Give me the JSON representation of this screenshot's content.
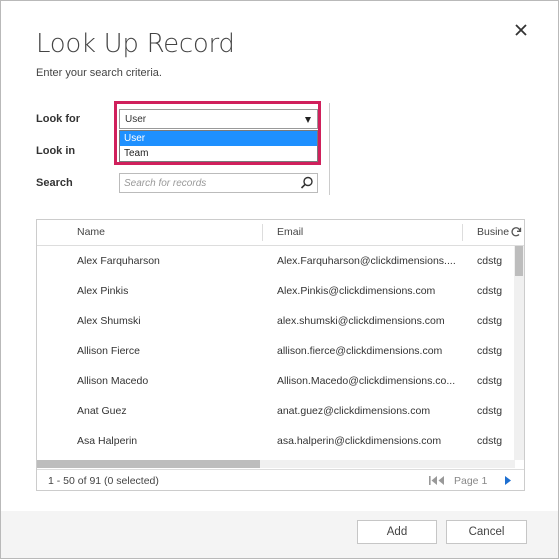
{
  "dialog": {
    "title": "Look Up Record",
    "subtitle": "Enter your search criteria."
  },
  "form": {
    "look_for_label": "Look for",
    "look_in_label": "Look in",
    "search_label": "Search",
    "look_for_value": "User",
    "look_for_options": [
      "User",
      "Team"
    ],
    "search_placeholder": "Search for records"
  },
  "grid": {
    "columns": [
      "Name",
      "Email",
      "Busine"
    ],
    "rows": [
      {
        "name": "Alex Farquharson",
        "email": "Alex.Farquharson@clickdimensions....",
        "business": "cdstg"
      },
      {
        "name": "Alex Pinkis",
        "email": "Alex.Pinkis@clickdimensions.com",
        "business": "cdstg"
      },
      {
        "name": "Alex Shumski",
        "email": "alex.shumski@clickdimensions.com",
        "business": "cdstg"
      },
      {
        "name": "Allison Fierce",
        "email": "allison.fierce@clickdimensions.com",
        "business": "cdstg"
      },
      {
        "name": "Allison Macedo",
        "email": "Allison.Macedo@clickdimensions.co...",
        "business": "cdstg"
      },
      {
        "name": "Anat Guez",
        "email": "anat.guez@clickdimensions.com",
        "business": "cdstg"
      },
      {
        "name": "Asa Halperin",
        "email": "asa.halperin@clickdimensions.com",
        "business": "cdstg"
      }
    ],
    "footer_info": "1 - 50  of 91 (0 selected)",
    "page_label": "Page 1"
  },
  "buttons": {
    "add": "Add",
    "cancel": "Cancel"
  },
  "colors": {
    "highlight": "#d0205c",
    "selected_option": "#1e90ff",
    "pager_arrow": "#1e6fd0"
  }
}
